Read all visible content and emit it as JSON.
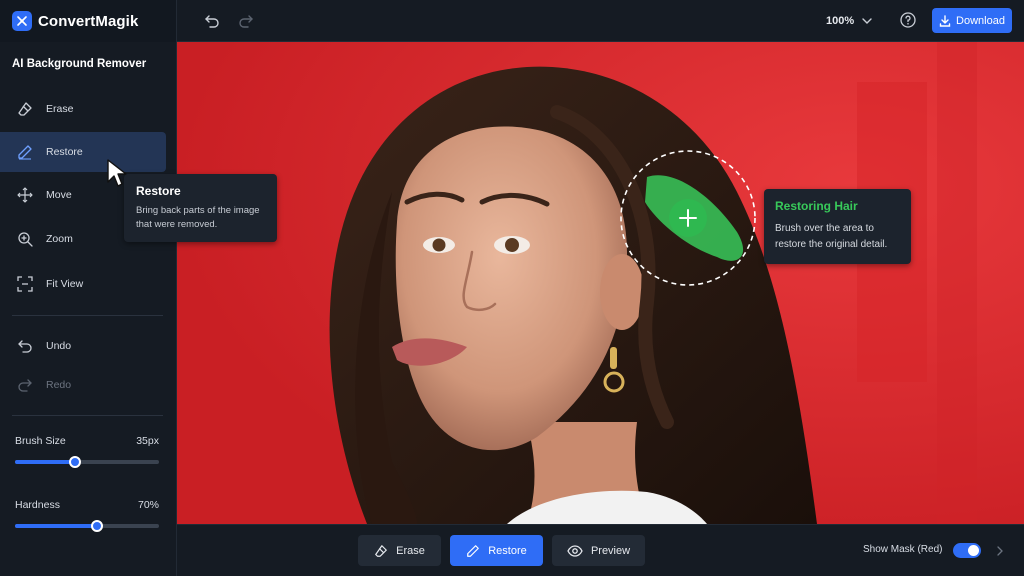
{
  "app": {
    "name": "ConvertMagik"
  },
  "topbar": {
    "zoom_value": "100%",
    "download_label": "Download"
  },
  "sidebar": {
    "title": "AI Background Remover",
    "tools": [
      {
        "label": "Erase",
        "icon": "eraser-icon"
      },
      {
        "label": "Restore",
        "icon": "pen-icon",
        "active": true
      },
      {
        "label": "Move",
        "icon": "move-icon"
      },
      {
        "label": "Zoom",
        "icon": "zoom-icon"
      },
      {
        "label": "Fit View",
        "icon": "fit-view-icon"
      }
    ],
    "history": [
      {
        "label": "Undo",
        "icon": "undo-icon"
      },
      {
        "label": "Redo",
        "icon": "redo-icon",
        "disabled": true
      }
    ],
    "brush_size": {
      "label": "Brush Size",
      "value": "35px",
      "fraction": 0.42
    },
    "hardness": {
      "label": "Hardness",
      "value": "70%",
      "fraction": 0.57
    }
  },
  "tooltip_sidebar": {
    "title": "Restore",
    "description": "Bring back parts of the image that were removed."
  },
  "tooltip_canvas": {
    "title": "Restoring Hair",
    "description": "Brush over the area to restore the original detail."
  },
  "bottombar": {
    "erase_label": "Erase",
    "restore_label": "Restore",
    "preview_label": "Preview",
    "show_mask_label": "Show Mask (Red)",
    "show_mask_on": true
  },
  "colors": {
    "accent": "#2f6df6",
    "mask": "#e02a2e",
    "restore_brush": "#38c95a",
    "panel": "#151b23"
  }
}
